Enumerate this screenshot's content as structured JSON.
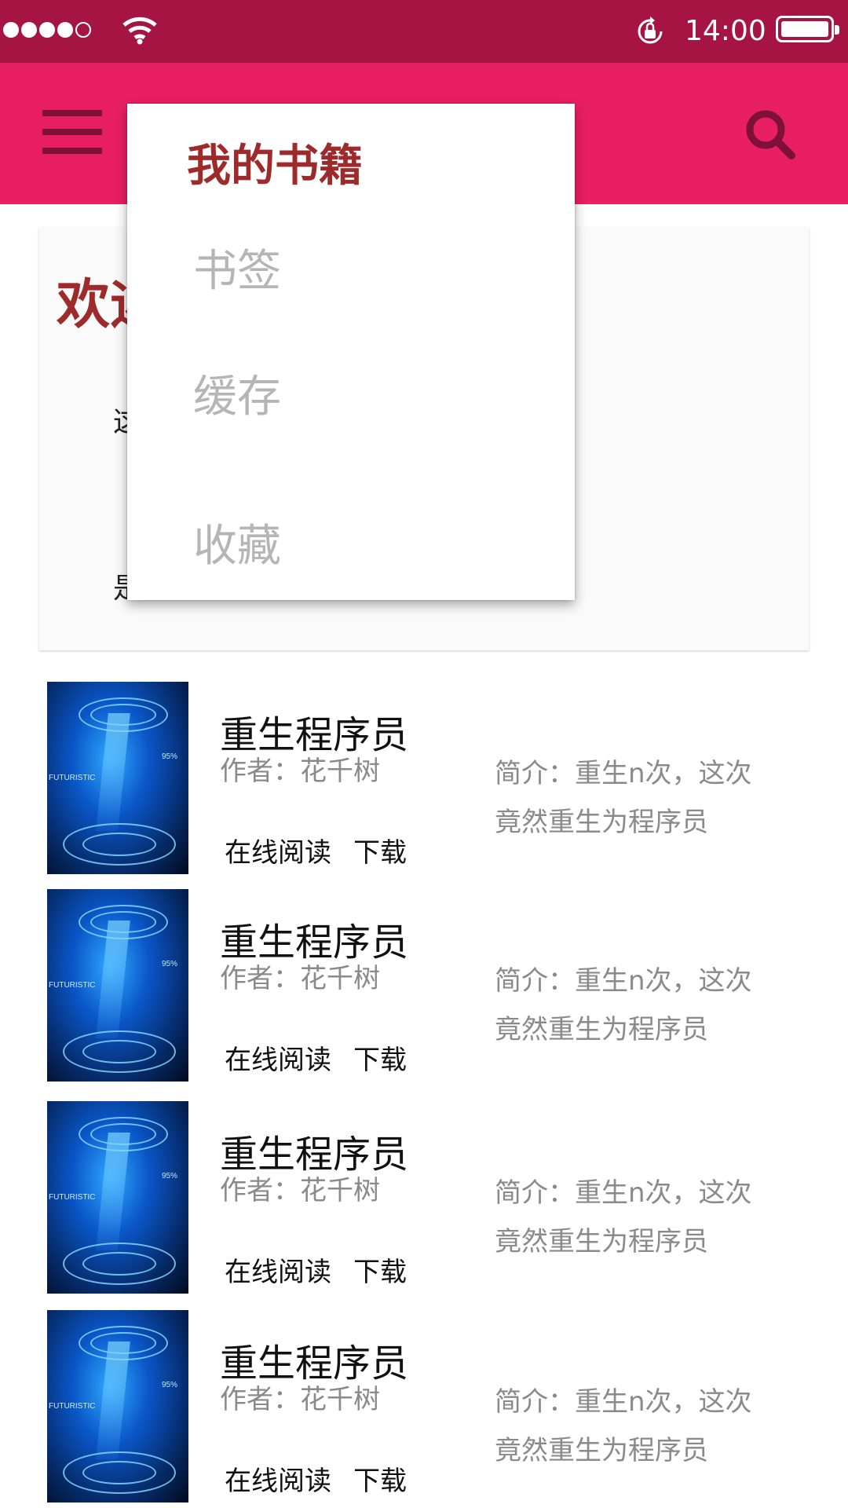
{
  "status_bar": {
    "time": "14:00",
    "signal_icon": "signal-dots-icon",
    "wifi_icon": "wifi-icon",
    "rotation_lock_icon": "rotation-lock-icon",
    "battery_icon": "battery-icon"
  },
  "app_bar": {
    "menu_icon": "hamburger-menu-icon",
    "search_icon": "search-icon",
    "color": "#e91f63",
    "status_color": "#a51443"
  },
  "dropdown": {
    "header": "我的书籍",
    "items": [
      {
        "label": "书签"
      },
      {
        "label": "缓存"
      },
      {
        "label": "收藏"
      }
    ]
  },
  "welcome_card": {
    "title": "欢迎",
    "line1": "这",
    "line2": "是"
  },
  "books": [
    {
      "title": "重生程序员",
      "author": "作者：花千树",
      "intro": "简介：重生n次，这次竟然重生为程序员",
      "read_label": "在线阅读",
      "download_label": "下载",
      "cover_title": "FUTURISTIC",
      "cover_pct": "95%"
    },
    {
      "title": "重生程序员",
      "author": "作者：花千树",
      "intro": "简介：重生n次，这次竟然重生为程序员",
      "read_label": "在线阅读",
      "download_label": "下载",
      "cover_title": "FUTURISTIC",
      "cover_pct": "95%"
    },
    {
      "title": "重生程序员",
      "author": "作者：花千树",
      "intro": "简介：重生n次，这次竟然重生为程序员",
      "read_label": "在线阅读",
      "download_label": "下载",
      "cover_title": "FUTURISTIC",
      "cover_pct": "95%"
    },
    {
      "title": "重生程序员",
      "author": "作者：花千树",
      "intro": "简介：重生n次，这次竟然重生为程序员",
      "read_label": "在线阅读",
      "download_label": "下载",
      "cover_title": "FUTURISTIC",
      "cover_pct": "95%"
    }
  ]
}
